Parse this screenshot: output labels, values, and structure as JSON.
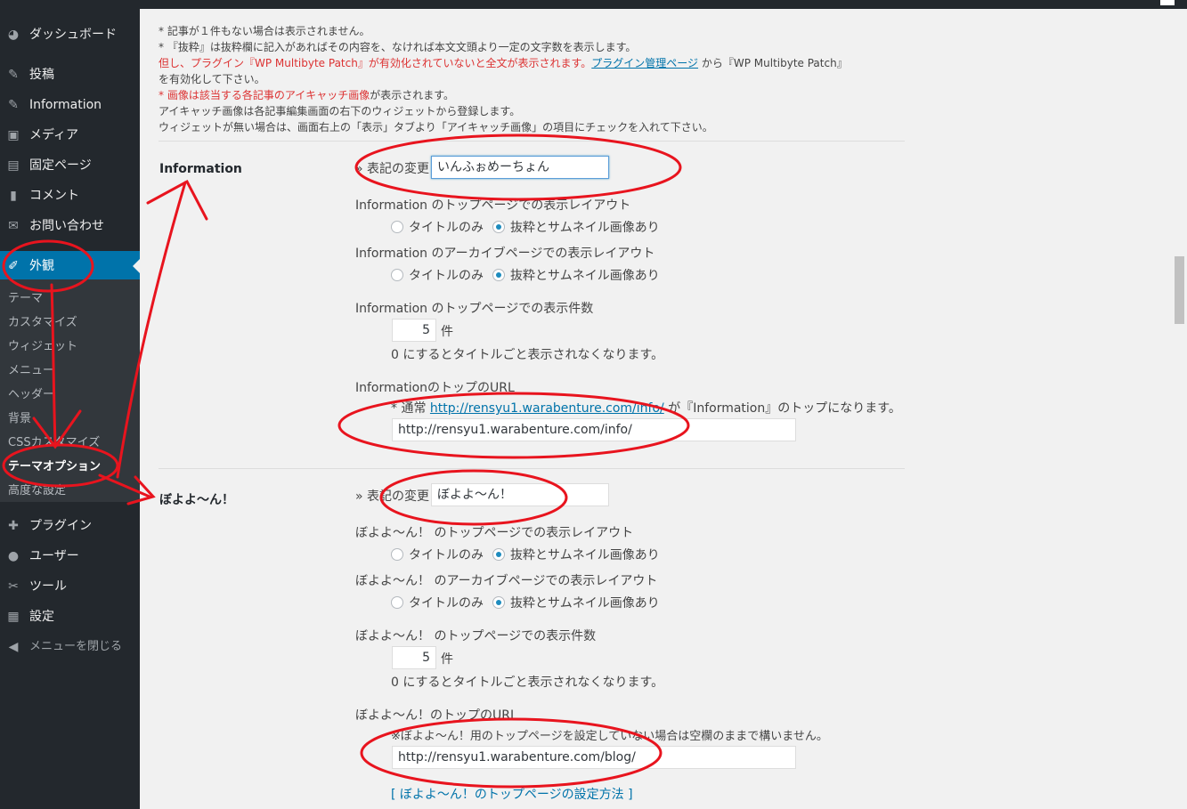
{
  "sidebar": {
    "items": [
      {
        "label": "ダッシュボード",
        "icon": "dashboard-icon",
        "glyph": "◕"
      },
      {
        "label": "投稿",
        "icon": "pin-icon",
        "glyph": "✎"
      },
      {
        "label": "Information",
        "icon": "pin-icon",
        "glyph": "✎"
      },
      {
        "label": "メディア",
        "icon": "media-icon",
        "glyph": "▣"
      },
      {
        "label": "固定ページ",
        "icon": "page-icon",
        "glyph": "▤"
      },
      {
        "label": "コメント",
        "icon": "comment-icon",
        "glyph": "▮"
      },
      {
        "label": "お問い合わせ",
        "icon": "mail-icon",
        "glyph": "✉"
      },
      {
        "label": "外観",
        "icon": "paintbrush-icon",
        "glyph": "✐"
      }
    ],
    "submenu": [
      "テーマ",
      "カスタマイズ",
      "ウィジェット",
      "メニュー",
      "ヘッダー",
      "背景",
      "CSSカスタマイズ",
      "テーマオプション",
      "高度な設定"
    ],
    "items2": [
      {
        "label": "プラグイン",
        "icon": "plugin-icon",
        "glyph": "✚"
      },
      {
        "label": "ユーザー",
        "icon": "user-icon",
        "glyph": "●"
      },
      {
        "label": "ツール",
        "icon": "wrench-icon",
        "glyph": "✂"
      },
      {
        "label": "設定",
        "icon": "settings-icon",
        "glyph": "▦"
      }
    ],
    "collapse_label": "メニューを閉じる",
    "collapse_glyph": "◀"
  },
  "notes": {
    "line1": "* 記事が１件もない場合は表示されません。",
    "line2": "* 『抜粋』は抜粋欄に記入があればその内容を、なければ本文文頭より一定の文字数を表示します。",
    "line3_red": "但し、プラグイン『WP Multibyte Patch』が有効化されていないと全文が表示されます。",
    "line3_link": "プラグイン管理ページ",
    "line3_rest": " から『WP Multibyte Patch』",
    "line4": "を有効化して下さい。",
    "line5_red": "* 画像は該当する各記事のアイキャッチ画像",
    "line5_rest": "が表示されます。",
    "line6": "アイキャッチ画像は各記事編集画面の右下のウィジェットから登録します。",
    "line7": "ウィジェットが無い場合は、画面右上の「表示」タブより「アイキャッチ画像」の項目にチェックを入れて下さい。"
  },
  "sections": [
    {
      "title": "Information",
      "rename_label": "» 表記の変更",
      "rename_value": "いんふぉめーちょん",
      "top_layout_label": "Information のトップページでの表示レイアウト",
      "archive_layout_label": "Information のアーカイブページでの表示レイアウト",
      "opt_title_only": "タイトルのみ",
      "opt_excerpt_thumb": "抜粋とサムネイル画像あり",
      "count_label": "Information のトップページでの表示件数",
      "count_value": "5",
      "count_unit": "件",
      "count_desc": "0 にするとタイトルごと表示されなくなります。",
      "url_label": "InformationのトップのURL",
      "url_note_prefix": "* 通常 ",
      "url_note_link": "http://rensyu1.warabenture.com/info/",
      "url_note_suffix": " が『Information』のトップになります。",
      "url_value": "http://rensyu1.warabenture.com/info/"
    },
    {
      "title": "ぼよよ〜ん！",
      "rename_label": "» 表記の変更",
      "rename_value": "ぼよよ〜ん！",
      "top_layout_label": "ぼよよ〜ん！ のトップページでの表示レイアウト",
      "archive_layout_label": "ぼよよ〜ん！ のアーカイブページでの表示レイアウト",
      "opt_title_only": "タイトルのみ",
      "opt_excerpt_thumb": "抜粋とサムネイル画像あり",
      "count_label": "ぼよよ〜ん！ のトップページでの表示件数",
      "count_value": "5",
      "count_unit": "件",
      "count_desc": "0 にするとタイトルごと表示されなくなります。",
      "url_label": "ぼよよ〜ん！のトップのURL",
      "url_note": "※ぼよよ〜ん！用のトップページを設定していない場合は空欄のままで構いません。",
      "url_value": "http://rensyu1.warabenture.com/blog/",
      "help_prefix": "[ ",
      "help_link": "ぼよよ〜ん！のトップページの設定方法",
      "help_suffix": " ]"
    }
  ],
  "colors": {
    "sidebar_bg": "#23282d",
    "active_bg": "#0073aa",
    "annotation": "#e8141e"
  }
}
